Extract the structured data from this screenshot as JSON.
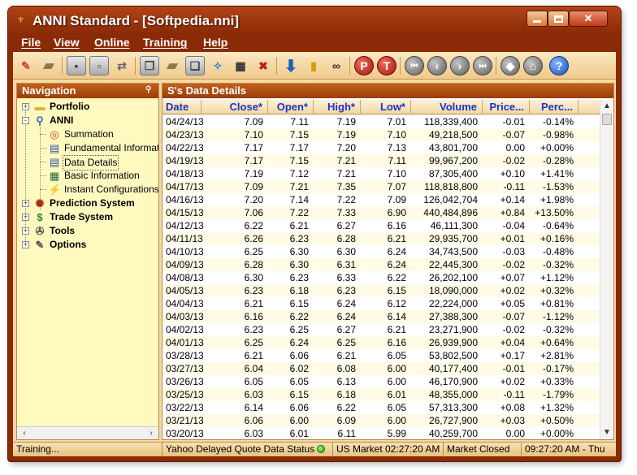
{
  "window": {
    "title": "ANNI Standard - [Softpedia.nni]",
    "controls": {
      "minimize": "minimize-button",
      "maximize": "maximize-button",
      "close": "close-button"
    }
  },
  "menu": [
    "File",
    "View",
    "Online",
    "Training",
    "Help"
  ],
  "toolbar": {
    "buttons": [
      "new-document-icon",
      "open-folder-icon",
      "save-icon",
      "save-as-icon",
      "swap-icon",
      "copy-icon",
      "open-icon",
      "export-icon",
      "settings-icon",
      "grid-icon",
      "delete-icon",
      "download-icon",
      "bar-chart-icon",
      "binoculars-icon",
      "p-icon",
      "t-icon",
      "first-icon",
      "previous-icon",
      "next-icon",
      "last-icon",
      "globe-icon",
      "home-icon",
      "help-icon"
    ],
    "p_label": "P",
    "t_label": "T",
    "help_label": "?"
  },
  "navigation": {
    "title": "Navigation",
    "tree": [
      {
        "label": "Portfolio",
        "icon": "folder-icon",
        "level": 0,
        "expander": "+"
      },
      {
        "label": "ANNI",
        "icon": "magnifier-icon",
        "level": 0,
        "expander": "-"
      },
      {
        "label": "Summation",
        "icon": "target-icon",
        "level": 1
      },
      {
        "label": "Fundamental Information",
        "icon": "table-icon",
        "level": 1
      },
      {
        "label": "Data Details",
        "icon": "table-icon",
        "level": 1,
        "selected": true
      },
      {
        "label": "Basic Information",
        "icon": "grid-icon",
        "level": 1
      },
      {
        "label": "Instant Configurations",
        "icon": "wand-icon",
        "level": 1
      },
      {
        "label": "Prediction System",
        "icon": "network-icon",
        "level": 0,
        "expander": "+"
      },
      {
        "label": "Trade System",
        "icon": "dollar-icon",
        "level": 0,
        "expander": "+"
      },
      {
        "label": "Tools",
        "icon": "wrench-icon",
        "level": 0,
        "expander": "+"
      },
      {
        "label": "Options",
        "icon": "options-icon",
        "level": 0,
        "expander": "+"
      }
    ]
  },
  "data_panel": {
    "title": "S's Data Details",
    "columns": [
      "Date",
      "Close*",
      "Open*",
      "High*",
      "Low*",
      "Volume",
      "Price...",
      "Perc..."
    ],
    "rows": [
      [
        "04/24/13",
        "7.09",
        "7.11",
        "7.19",
        "7.01",
        "118,339,400",
        "-0.01",
        "-0.14%"
      ],
      [
        "04/23/13",
        "7.10",
        "7.15",
        "7.19",
        "7.10",
        "49,218,500",
        "-0.07",
        "-0.98%"
      ],
      [
        "04/22/13",
        "7.17",
        "7.17",
        "7.20",
        "7.13",
        "43,801,700",
        "0.00",
        "+0.00%"
      ],
      [
        "04/19/13",
        "7.17",
        "7.15",
        "7.21",
        "7.11",
        "99,967,200",
        "-0.02",
        "-0.28%"
      ],
      [
        "04/18/13",
        "7.19",
        "7.12",
        "7.21",
        "7.10",
        "87,305,400",
        "+0.10",
        "+1.41%"
      ],
      [
        "04/17/13",
        "7.09",
        "7.21",
        "7.35",
        "7.07",
        "118,818,800",
        "-0.11",
        "-1.53%"
      ],
      [
        "04/16/13",
        "7.20",
        "7.14",
        "7.22",
        "7.09",
        "126,042,704",
        "+0.14",
        "+1.98%"
      ],
      [
        "04/15/13",
        "7.06",
        "7.22",
        "7.33",
        "6.90",
        "440,484,896",
        "+0.84",
        "+13.50%"
      ],
      [
        "04/12/13",
        "6.22",
        "6.21",
        "6.27",
        "6.16",
        "46,111,300",
        "-0.04",
        "-0.64%"
      ],
      [
        "04/11/13",
        "6.26",
        "6.23",
        "6.28",
        "6.21",
        "29,935,700",
        "+0.01",
        "+0.16%"
      ],
      [
        "04/10/13",
        "6.25",
        "6.30",
        "6.30",
        "6.24",
        "34,743,500",
        "-0.03",
        "-0.48%"
      ],
      [
        "04/09/13",
        "6.28",
        "6.30",
        "6.31",
        "6.24",
        "22,445,300",
        "-0.02",
        "-0.32%"
      ],
      [
        "04/08/13",
        "6.30",
        "6.23",
        "6.33",
        "6.22",
        "26,202,100",
        "+0.07",
        "+1.12%"
      ],
      [
        "04/05/13",
        "6.23",
        "6.18",
        "6.23",
        "6.15",
        "18,090,000",
        "+0.02",
        "+0.32%"
      ],
      [
        "04/04/13",
        "6.21",
        "6.15",
        "6.24",
        "6.12",
        "22,224,000",
        "+0.05",
        "+0.81%"
      ],
      [
        "04/03/13",
        "6.16",
        "6.22",
        "6.24",
        "6.14",
        "27,388,300",
        "-0.07",
        "-1.12%"
      ],
      [
        "04/02/13",
        "6.23",
        "6.25",
        "6.27",
        "6.21",
        "23,271,900",
        "-0.02",
        "-0.32%"
      ],
      [
        "04/01/13",
        "6.25",
        "6.24",
        "6.25",
        "6.16",
        "26,939,900",
        "+0.04",
        "+0.64%"
      ],
      [
        "03/28/13",
        "6.21",
        "6.06",
        "6.21",
        "6.05",
        "53,802,500",
        "+0.17",
        "+2.81%"
      ],
      [
        "03/27/13",
        "6.04",
        "6.02",
        "6.08",
        "6.00",
        "40,177,400",
        "-0.01",
        "-0.17%"
      ],
      [
        "03/26/13",
        "6.05",
        "6.05",
        "6.13",
        "6.00",
        "46,170,900",
        "+0.02",
        "+0.33%"
      ],
      [
        "03/25/13",
        "6.03",
        "6.15",
        "6.18",
        "6.01",
        "48,355,000",
        "-0.11",
        "-1.79%"
      ],
      [
        "03/22/13",
        "6.14",
        "6.06",
        "6.22",
        "6.05",
        "57,313,300",
        "+0.08",
        "+1.32%"
      ],
      [
        "03/21/13",
        "6.06",
        "6.00",
        "6.09",
        "6.00",
        "26,727,900",
        "+0.03",
        "+0.50%"
      ],
      [
        "03/20/13",
        "6.03",
        "6.01",
        "6.11",
        "5.99",
        "40,259,700",
        "0.00",
        "+0.00%"
      ]
    ]
  },
  "status": {
    "left": "Training...",
    "feed": "Yahoo Delayed Quote Data Status",
    "market_time": "US Market 02:27:20 AM",
    "market_state": "Market Closed",
    "clock": "09:27:20 AM - Thu"
  },
  "colors": {
    "frame": "#8c2a05",
    "header_text": "#1e33c8",
    "nav_bg": "#fff9c0"
  }
}
